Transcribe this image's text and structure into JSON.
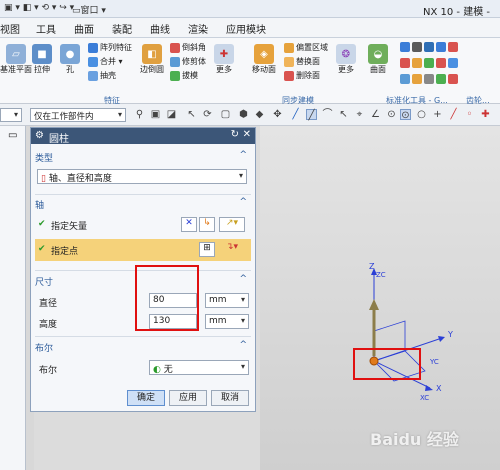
{
  "window": {
    "title": "NX 10 - 建模 -",
    "quick_menu": "窗口"
  },
  "menu": {
    "tabs": [
      "视图",
      "工具",
      "曲面",
      "装配",
      "曲线",
      "渲染",
      "应用模块"
    ]
  },
  "ribbon": {
    "feature_items": [
      {
        "label": "基准平面",
        "icon": "datum-plane-icon"
      },
      {
        "label": "拉伸",
        "icon": "extrude-icon"
      },
      {
        "label": "孔",
        "icon": "hole-icon"
      }
    ],
    "feature_small": [
      "阵列特征",
      "合并 ▾",
      "抽壳"
    ],
    "edge_items": {
      "label": "边倒圆",
      "small": [
        "倒斜角",
        "修剪体",
        "拔模"
      ]
    },
    "more1": "更多",
    "move_face": "移动面",
    "sync_small": [
      "偏置区域",
      "替换面",
      "删除面"
    ],
    "more2": "更多",
    "surface": "曲面",
    "groups": {
      "feature": "特征",
      "sync": "同步建模",
      "std": "标准化工具 - G...",
      "gear": "齿轮..."
    }
  },
  "selection_bar": {
    "filter_value": "",
    "scope_value": "仅在工作部件内"
  },
  "dialog": {
    "title": "圆柱",
    "type_header": "类型",
    "type_value": "轴、直径和高度",
    "axis_header": "轴",
    "specify_vector": "指定矢量",
    "specify_point": "指定点",
    "dims_header": "尺寸",
    "diameter_label": "直径",
    "diameter_value": "80",
    "diameter_unit": "mm",
    "height_label": "高度",
    "height_value": "130",
    "height_unit": "mm",
    "bool_header": "布尔",
    "bool_label": "布尔",
    "bool_value": "无",
    "ok": "确定",
    "apply": "应用",
    "cancel": "取消"
  },
  "viewport": {
    "axis_z": "Z",
    "axis_y": "Y",
    "axis_x": "X",
    "axis_zc": "ZC",
    "axis_yc": "YC",
    "axis_xc": "XC"
  },
  "watermark": "Baidu 经验",
  "colors": {
    "title_bar": "#3c5678",
    "highlight_row": "#f5d27a",
    "red_box": "#e01010",
    "axis_blue": "#2b3fd6"
  }
}
